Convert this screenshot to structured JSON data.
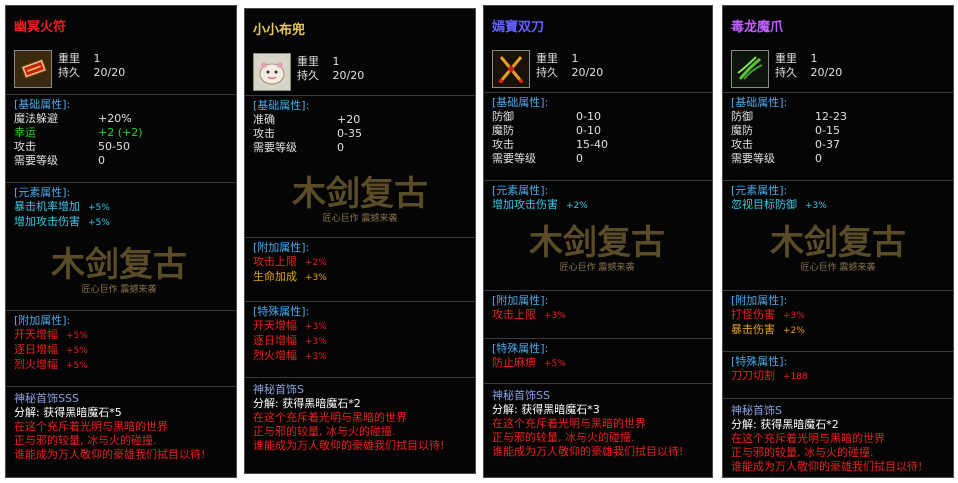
{
  "cards": [
    {
      "name": "幽冥火符",
      "name_color": "#e82020",
      "icon": "fire-talisman-icon",
      "weight_label": "重里",
      "weight_value": "1",
      "dur_label": "持久",
      "dur_value": "20/20",
      "basic_header": "[基础属性]:",
      "basic": [
        {
          "k": "魔法躲避",
          "v": "+20%"
        },
        {
          "k": "幸运",
          "v": "+2 (+2)"
        },
        {
          "k": "攻击",
          "v": "50-50"
        },
        {
          "k": "需要等级",
          "v": "0"
        }
      ],
      "element_header": "[元素属性]:",
      "element": [
        {
          "k": "暴击机率增加",
          "v": "+5%"
        },
        {
          "k": "增加攻击伤害",
          "v": "+5%"
        }
      ],
      "extra_header": "[附加属性]:",
      "extra": [
        {
          "k": "开天增幅",
          "v": "+5%"
        },
        {
          "k": "逐日增幅",
          "v": "+5%"
        },
        {
          "k": "烈火增幅",
          "v": "+5%"
        }
      ],
      "rarity": "神秘首饰SSS",
      "decompose": "分解: 获得黑暗魔石*5",
      "lore": [
        "在这个充斥着光明与黑暗的世界",
        "正与邪的较量, 冰与火的碰撞.",
        "谁能成为万人敬仰的豪雄我们拭目以待!"
      ]
    },
    {
      "name": "小小布兜",
      "name_color": "#e8c860",
      "icon": "cloth-pouch-icon",
      "weight_label": "重里",
      "weight_value": "1",
      "dur_label": "持久",
      "dur_value": "20/20",
      "basic_header": "[基础属性]:",
      "basic": [
        {
          "k": "准确",
          "v": "+20"
        },
        {
          "k": "攻击",
          "v": "0-35"
        },
        {
          "k": "需要等级",
          "v": "0"
        }
      ],
      "extra_header": "[附加属性]:",
      "extra": [
        {
          "k": "攻击上限",
          "v": "+2%"
        },
        {
          "k": "生命加成",
          "v": "+3%"
        }
      ],
      "special_header": "[特殊属性]:",
      "special": [
        {
          "k": "开天增幅",
          "v": "+3%"
        },
        {
          "k": "逐日增幅",
          "v": "+3%"
        },
        {
          "k": "烈火增幅",
          "v": "+3%"
        }
      ],
      "rarity": "神秘首饰S",
      "decompose": "分解: 获得黑暗魔石*2",
      "lore": [
        "在这个充斥着光明与黑暗的世界",
        "正与邪的较量, 冰与火的碰撞.",
        "谁能成为万人敬仰的豪雄我们拭目以待!"
      ]
    },
    {
      "name": "嫣寶双刀",
      "name_color": "#6060ff",
      "icon": "twin-blades-icon",
      "weight_label": "重里",
      "weight_value": "1",
      "dur_label": "持久",
      "dur_value": "20/20",
      "basic_header": "[基础属性]:",
      "basic": [
        {
          "k": "防御",
          "v": "0-10"
        },
        {
          "k": "魔防",
          "v": "0-10"
        },
        {
          "k": "攻击",
          "v": "15-40"
        },
        {
          "k": "需要等级",
          "v": "0"
        }
      ],
      "element_header": "[元素属性]:",
      "element": [
        {
          "k": "增加攻击伤害",
          "v": "+2%"
        }
      ],
      "extra_header": "[附加属性]:",
      "extra": [
        {
          "k": "攻击上限",
          "v": "+3%"
        }
      ],
      "special_header": "[特殊属性]:",
      "special": [
        {
          "k": "防止麻痹",
          "v": "+5%"
        }
      ],
      "rarity": "神秘首饰SS",
      "decompose": "分解: 获得黑暗魔石*3",
      "lore": [
        "在这个充斥着光明与黑暗的世界",
        "正与邪的较量, 冰与火的碰撞.",
        "谁能成为万人敬仰的豪雄我们拭目以待!"
      ]
    },
    {
      "name": "毒龙魔爪",
      "name_color": "#c060ff",
      "icon": "dragon-claw-icon",
      "weight_label": "重里",
      "weight_value": "1",
      "dur_label": "持久",
      "dur_value": "20/20",
      "basic_header": "[基础属性]:",
      "basic": [
        {
          "k": "防御",
          "v": "12-23"
        },
        {
          "k": "魔防",
          "v": "0-15"
        },
        {
          "k": "攻击",
          "v": "0-37"
        },
        {
          "k": "需要等级",
          "v": "0"
        }
      ],
      "element_header": "[元素属性]:",
      "element": [
        {
          "k": "忽视目标防御",
          "v": "+3%"
        }
      ],
      "extra_header": "[附加属性]:",
      "extra": [
        {
          "k": "打怪伤害",
          "v": "+3%"
        },
        {
          "k": "暴击伤害",
          "v": "+2%"
        }
      ],
      "special_header": "[特殊属性]:",
      "special": [
        {
          "k": "刀刀切割",
          "v": "+188"
        }
      ],
      "rarity": "神秘首饰S",
      "decompose": "分解: 获得黑暗魔石*2",
      "lore": [
        "在这个充斥着光明与黑暗的世界",
        "正与邪的较量, 冰与火的碰撞.",
        "谁能成为万人敬仰的豪雄我们拭目以待!"
      ]
    }
  ],
  "watermark": {
    "logo": "木剑复古",
    "slogan": "匠心巨作 震撼来袭"
  }
}
